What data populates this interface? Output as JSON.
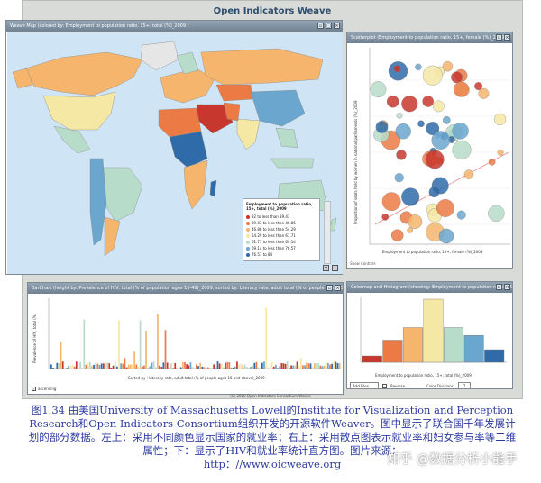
{
  "app": {
    "title": "Open Indicators Weave",
    "copyright": "(C) 2010 Open Indicators Consortium Weave"
  },
  "map_panel": {
    "header": "Weave Map (colored by: Employment to population ratio, 15+, total (%)_2009 )",
    "legend": {
      "title": "Employment to population ratio, 15+, total (%)_2009",
      "items": [
        {
          "label": "32 to less than 39.43",
          "color": "#c8372d"
        },
        {
          "label": "39.43 to less than 46.86",
          "color": "#ec7a45"
        },
        {
          "label": "46.86 to less than 54.29",
          "color": "#f6b56d"
        },
        {
          "label": "54.29 to less than 61.71",
          "color": "#f5e8a4"
        },
        {
          "label": "61.71 to less than 69.14",
          "color": "#b7dcc9"
        },
        {
          "label": "69.14 to less than 76.57",
          "color": "#6aa6ce"
        },
        {
          "label": "76.57 to 84",
          "color": "#2f6ba8"
        }
      ]
    },
    "controls": [
      "+",
      "-"
    ]
  },
  "scatter_panel": {
    "header": "Scatterplot (Employment to population ratio, 15+, female (%)_2009 )",
    "x_label": "Employment to population ratio, 15+, female (%)_2009",
    "y_label": "Proportion of seats held by women in national parliaments (%)_2009",
    "show_controls": "Show Controls"
  },
  "bar_panel": {
    "header": "BarChart (height by: Prevalence of HIV, total (% of population ages 15-49)_2009, sorted by: Literacy rate, adult total (% of people ages 15 and above)_2009)",
    "y_label": "Prevalence of HIV, total (%)",
    "x_label": "Sorted by : Literacy rate, adult total (% of people ages 15 and above)_2009",
    "ascending_label": "ascending"
  },
  "hist_panel": {
    "header": "Colormap and Histogram (showing: Employment to population ratio, 15+, total(%)_2009)",
    "x_label": "Employment to population ratio, 15+, total (%)_2009",
    "bins": [
      {
        "label": "32-39",
        "count": 4,
        "color": "#c8372d"
      },
      {
        "label": "39-47",
        "count": 14,
        "color": "#ec7a45"
      },
      {
        "label": "47-54",
        "count": 22,
        "color": "#f6b56d"
      },
      {
        "label": "54-62",
        "count": 40,
        "color": "#f5e8a4"
      },
      {
        "label": "62-69",
        "count": 22,
        "color": "#b7dcc9"
      },
      {
        "label": "69-77",
        "count": 17,
        "color": "#6aa6ce"
      },
      {
        "label": "77-84",
        "count": 8,
        "color": "#2f6ba8"
      }
    ],
    "bottom": {
      "select_value": "Add Files",
      "reverse_label": "Reverse",
      "color_divisions_label": "Color Divisions:",
      "color_divisions_value": "7"
    }
  },
  "caption": {
    "text": "图1.34 由美国University of Massachusetts Lowell的Institute for Visualization and Perception Research和Open Indicators Consortium组织开发的开源软件Weaver。图中显示了联合国千年发展计划的部分数据。左上：采用不同颜色显示国家的就业率；右上：采用散点图表示就业率和妇女参与率等二维属性；下：显示了HIV和就业率统计直方图。图片来源：",
    "url": "http：//www.oicweave.org"
  },
  "watermark": "知乎 @数据分析小能手"
}
